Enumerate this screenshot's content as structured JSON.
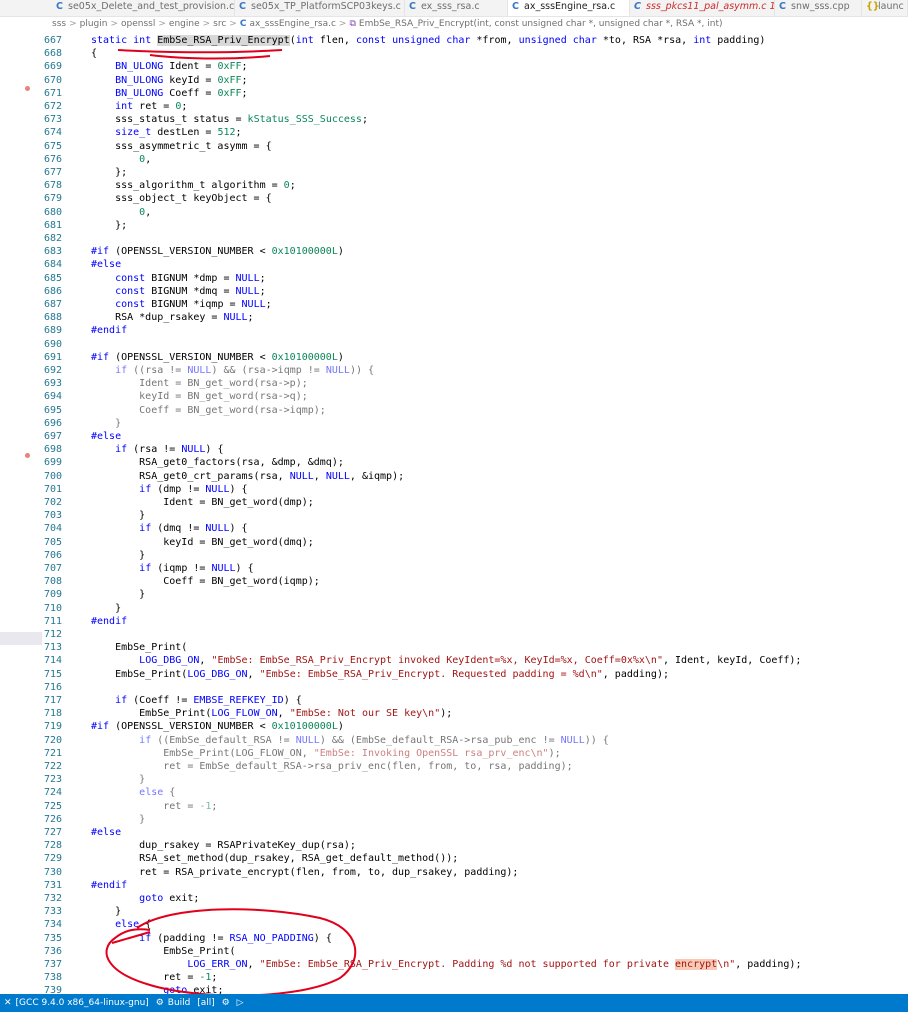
{
  "tabs": [
    {
      "label": "se05x_Delete_and_test_provision.c",
      "icon": "C",
      "active": false,
      "error": false
    },
    {
      "label": "se05x_TP_PlatformSCP03keys.c",
      "icon": "C",
      "active": false,
      "error": false
    },
    {
      "label": "ex_sss_rsa.c",
      "icon": "C",
      "active": false,
      "error": false
    },
    {
      "label": "ax_sssEngine_rsa.c",
      "icon": "C",
      "active": true,
      "error": false
    },
    {
      "label": "sss_pkcs11_pal_asymm.c 1",
      "icon": "C",
      "active": false,
      "error": true
    },
    {
      "label": "snw_sss.cpp",
      "icon": "C",
      "active": false,
      "error": false
    },
    {
      "label": "launc",
      "icon": "{}",
      "active": false,
      "error": false
    }
  ],
  "breadcrumb": {
    "parts": [
      "sss",
      "plugin",
      "openssl",
      "engine",
      "src"
    ],
    "file": "ax_sssEngine_rsa.c",
    "symbol": "EmbSe_RSA_Priv_Encrypt(int, const unsigned char *, unsigned char *, RSA *, int)"
  },
  "lines": [
    {
      "n": "667",
      "html": "<span class='kw'>static</span> <span class='kw'>int</span> <span class='hl-fn'>EmbSe_RSA_Priv_Encrypt</span>(<span class='kw'>int</span> flen, <span class='kw'>const</span> <span class='kw'>unsigned</span> <span class='kw'>char</span> *from, <span class='kw'>unsigned</span> <span class='kw'>char</span> *to, RSA *rsa, <span class='kw'>int</span> padding)"
    },
    {
      "n": "668",
      "html": "{"
    },
    {
      "n": "669",
      "html": "    <span class='kw'>BN_ULONG</span> Ident = <span class='num'>0xFF</span>;"
    },
    {
      "n": "670",
      "html": "    <span class='kw'>BN_ULONG</span> keyId = <span class='num'>0xFF</span>;"
    },
    {
      "n": "671",
      "html": "    <span class='kw'>BN_ULONG</span> Coeff = <span class='num'>0xFF</span>;"
    },
    {
      "n": "672",
      "html": "    <span class='kw'>int</span> ret = <span class='num'>0</span>;"
    },
    {
      "n": "673",
      "html": "    sss_status_t status = <span class='num'>kStatus_SSS_Success</span>;"
    },
    {
      "n": "674",
      "html": "    <span class='kw'>size_t</span> destLen = <span class='num'>512</span>;"
    },
    {
      "n": "675",
      "html": "    sss_asymmetric_t asymm = {"
    },
    {
      "n": "676",
      "html": "        <span class='num'>0</span>,"
    },
    {
      "n": "677",
      "html": "    };"
    },
    {
      "n": "678",
      "html": "    sss_algorithm_t algorithm = <span class='num'>0</span>;"
    },
    {
      "n": "679",
      "html": "    sss_object_t keyObject = {"
    },
    {
      "n": "680",
      "html": "        <span class='num'>0</span>,"
    },
    {
      "n": "681",
      "html": "    };"
    },
    {
      "n": "682",
      "html": ""
    },
    {
      "n": "683",
      "html": "<span class='pp'>#if</span> (OPENSSL_VERSION_NUMBER &lt; <span class='num'>0x10100000L</span>)"
    },
    {
      "n": "684",
      "html": "<span class='pp'>#else</span>"
    },
    {
      "n": "685",
      "html": "    <span class='kw'>const</span> BIGNUM *dmp = <span class='mac'>NULL</span>;"
    },
    {
      "n": "686",
      "html": "    <span class='kw'>const</span> BIGNUM *dmq = <span class='mac'>NULL</span>;"
    },
    {
      "n": "687",
      "html": "    <span class='kw'>const</span> BIGNUM *iqmp = <span class='mac'>NULL</span>;"
    },
    {
      "n": "688",
      "html": "    RSA *dup_rsakey = <span class='mac'>NULL</span>;"
    },
    {
      "n": "689",
      "html": "<span class='pp'>#endif</span>"
    },
    {
      "n": "690",
      "html": ""
    },
    {
      "n": "691",
      "html": "<span class='pp'>#if</span> (OPENSSL_VERSION_NUMBER &lt; <span class='num'>0x10100000L</span>)"
    },
    {
      "n": "692",
      "html": "<span class='dim'>    <span class='kw'>if</span> ((rsa != <span class='mac'>NULL</span>) &amp;&amp; (rsa-&gt;iqmp != <span class='mac'>NULL</span>)) {</span>"
    },
    {
      "n": "693",
      "html": "<span class='dim'>        Ident = BN_get_word(rsa-&gt;p);</span>"
    },
    {
      "n": "694",
      "html": "<span class='dim'>        keyId = BN_get_word(rsa-&gt;q);</span>"
    },
    {
      "n": "695",
      "html": "<span class='dim'>        Coeff = BN_get_word(rsa-&gt;iqmp);</span>"
    },
    {
      "n": "696",
      "html": "<span class='dim'>    }</span>"
    },
    {
      "n": "697",
      "html": "<span class='pp'>#else</span>"
    },
    {
      "n": "698",
      "html": "    <span class='kw'>if</span> (rsa != <span class='mac'>NULL</span>) {"
    },
    {
      "n": "699",
      "html": "        RSA_get0_factors(rsa, &amp;dmp, &amp;dmq);"
    },
    {
      "n": "700",
      "html": "        RSA_get0_crt_params(rsa, <span class='mac'>NULL</span>, <span class='mac'>NULL</span>, &amp;iqmp);"
    },
    {
      "n": "701",
      "html": "        <span class='kw'>if</span> (dmp != <span class='mac'>NULL</span>) {"
    },
    {
      "n": "702",
      "html": "            Ident = BN_get_word(dmp);"
    },
    {
      "n": "703",
      "html": "        }"
    },
    {
      "n": "704",
      "html": "        <span class='kw'>if</span> (dmq != <span class='mac'>NULL</span>) {"
    },
    {
      "n": "705",
      "html": "            keyId = BN_get_word(dmq);"
    },
    {
      "n": "706",
      "html": "        }"
    },
    {
      "n": "707",
      "html": "        <span class='kw'>if</span> (iqmp != <span class='mac'>NULL</span>) {"
    },
    {
      "n": "708",
      "html": "            Coeff = BN_get_word(iqmp);"
    },
    {
      "n": "709",
      "html": "        }"
    },
    {
      "n": "710",
      "html": "    }"
    },
    {
      "n": "711",
      "html": "<span class='pp'>#endif</span>"
    },
    {
      "n": "712",
      "html": ""
    },
    {
      "n": "713",
      "html": "    EmbSe_Print("
    },
    {
      "n": "714",
      "html": "        <span class='mac'>LOG_DBG_ON</span>, <span class='str'>\"EmbSe: EmbSe_RSA_Priv_Encrypt invoked KeyIdent=%x, KeyId=%x, Coeff=0x%x\\n\"</span>, Ident, keyId, Coeff);"
    },
    {
      "n": "715",
      "html": "    EmbSe_Print(<span class='mac'>LOG_DBG_ON</span>, <span class='str'>\"EmbSe: EmbSe_RSA_Priv_Encrypt. Requested padding = %d\\n\"</span>, padding);"
    },
    {
      "n": "716",
      "html": ""
    },
    {
      "n": "717",
      "html": "    <span class='kw'>if</span> (Coeff != <span class='mac'>EMBSE_REFKEY_ID</span>) {"
    },
    {
      "n": "718",
      "html": "        EmbSe_Print(<span class='mac'>LOG_FLOW_ON</span>, <span class='str'>\"EmbSe: Not our SE key\\n\"</span>);"
    },
    {
      "n": "719",
      "html": "<span class='pp'>#if</span> (OPENSSL_VERSION_NUMBER &lt; <span class='num'>0x10100000L</span>)"
    },
    {
      "n": "720",
      "html": "<span class='dim'>        <span class='kw'>if</span> ((EmbSe_default_RSA != <span class='mac'>NULL</span>) &amp;&amp; (EmbSe_default_RSA-&gt;rsa_pub_enc != <span class='mac'>NULL</span>)) {</span>"
    },
    {
      "n": "721",
      "html": "<span class='dim'>            EmbSe_Print(LOG_FLOW_ON, <span class='str'>\"EmbSe: Invoking OpenSSL rsa_prv_enc\\n\"</span>);</span>"
    },
    {
      "n": "722",
      "html": "<span class='dim'>            ret = EmbSe_default_RSA-&gt;rsa_priv_enc(flen, from, to, rsa, padding);</span>"
    },
    {
      "n": "723",
      "html": "<span class='dim'>        }</span>"
    },
    {
      "n": "724",
      "html": "<span class='dim'>        <span class='kw'>else</span> {</span>"
    },
    {
      "n": "725",
      "html": "<span class='dim'>            ret = <span class='num'>-1</span>;</span>"
    },
    {
      "n": "726",
      "html": "<span class='dim'>        }</span>"
    },
    {
      "n": "727",
      "html": "<span class='pp'>#else</span>"
    },
    {
      "n": "728",
      "html": "        dup_rsakey = RSAPrivateKey_dup(rsa);"
    },
    {
      "n": "729",
      "html": "        RSA_set_method(dup_rsakey, RSA_get_default_method());"
    },
    {
      "n": "730",
      "html": "        ret = RSA_private_encrypt(flen, from, to, dup_rsakey, padding);"
    },
    {
      "n": "731",
      "html": "<span class='pp'>#endif</span>"
    },
    {
      "n": "732",
      "html": "        <span class='kw'>goto</span> exit;"
    },
    {
      "n": "733",
      "html": "    }"
    },
    {
      "n": "734",
      "html": "    <span class='kw'>else</span> {"
    },
    {
      "n": "735",
      "html": "        <span class='kw'>if</span> (padding != <span class='mac'>RSA_NO_PADDING</span>) {"
    },
    {
      "n": "736",
      "html": "            EmbSe_Print("
    },
    {
      "n": "737",
      "html": "                <span class='mac'>LOG_ERR_ON</span>, <span class='str'>\"EmbSe: EmbSe_RSA_Priv_Encrypt. Padding %d not supported for private <span class='hl-find'>encrypt</span>\\n\"</span>, padding);"
    },
    {
      "n": "738",
      "html": "            ret = <span class='num'>-1</span>;"
    },
    {
      "n": "739",
      "html": "            <span class='kw'>goto</span> exit;"
    }
  ],
  "status": {
    "remote": "[GCC 9.4.0 x86_64-linux-gnu]",
    "build": "Build",
    "target": "[all]"
  }
}
